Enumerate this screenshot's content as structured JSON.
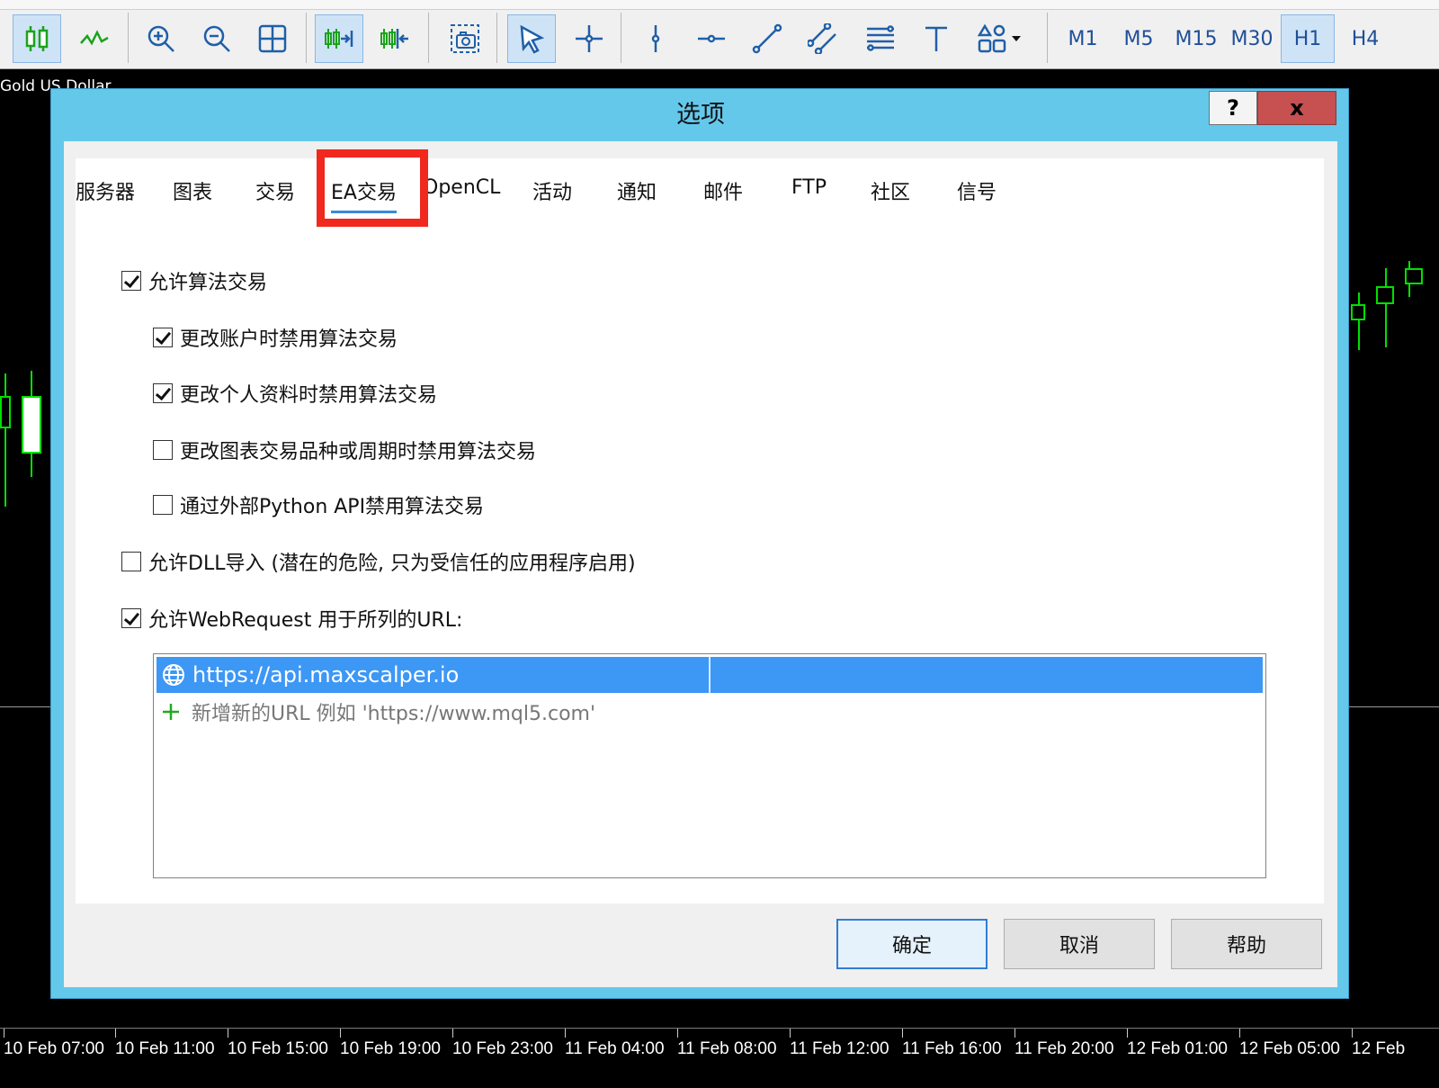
{
  "chart": {
    "symbol": "Gold US Dollar",
    "time_labels": [
      "10 Feb 07:00",
      "10 Feb 11:00",
      "10 Feb 15:00",
      "10 Feb 19:00",
      "10 Feb 23:00",
      "11 Feb 04:00",
      "11 Feb 08:00",
      "11 Feb 12:00",
      "11 Feb 16:00",
      "11 Feb 20:00",
      "12 Feb 01:00",
      "12 Feb 05:00",
      "12 Feb"
    ]
  },
  "toolbar": {
    "icons": [
      "candlestick-chart-icon",
      "line-chart-icon",
      "zoom-in-icon",
      "zoom-out-icon",
      "grid-icon",
      "autoscroll-icon",
      "chart-shift-icon",
      "screenshot-icon",
      "cursor-icon",
      "crosshair-icon",
      "vertical-line-icon",
      "horizontal-line-icon",
      "trend-line-icon",
      "channel-icon",
      "fibonacci-icon",
      "text-icon",
      "shapes-icon"
    ],
    "timeframes": [
      "M1",
      "M5",
      "M15",
      "M30",
      "H1",
      "H4"
    ],
    "active_timeframe": "H1"
  },
  "dialog": {
    "title": "选项",
    "help_glyph": "?",
    "close_glyph": "x",
    "tabs": [
      "服务器",
      "图表",
      "交易",
      "EA交易",
      "OpenCL",
      "活动",
      "通知",
      "邮件",
      "FTP",
      "社区",
      "信号"
    ],
    "active_tab": "EA交易",
    "options": [
      {
        "label": "允许算法交易",
        "checked": true
      },
      {
        "label": "更改账户时禁用算法交易",
        "checked": true
      },
      {
        "label": "更改个人资料时禁用算法交易",
        "checked": true
      },
      {
        "label": "更改图表交易品种或周期时禁用算法交易",
        "checked": false
      },
      {
        "label": "通过外部Python API禁用算法交易",
        "checked": false
      },
      {
        "label": "允许DLL导入 (潜在的危险, 只为受信任的应用程序启用)",
        "checked": false
      },
      {
        "label": "允许WebRequest 用于所列的URL:",
        "checked": true
      }
    ],
    "url_list": {
      "selected_url": "https://api.maxscalper.io",
      "add_hint": "新增新的URL 例如 'https://www.mql5.com'"
    },
    "buttons": {
      "ok": "确定",
      "cancel": "取消",
      "help": "帮助"
    }
  },
  "colors": {
    "dialog_frame": "#64c8eb",
    "highlight": "#f0281e",
    "selection": "#3d97f5",
    "candle": "#00e000"
  }
}
